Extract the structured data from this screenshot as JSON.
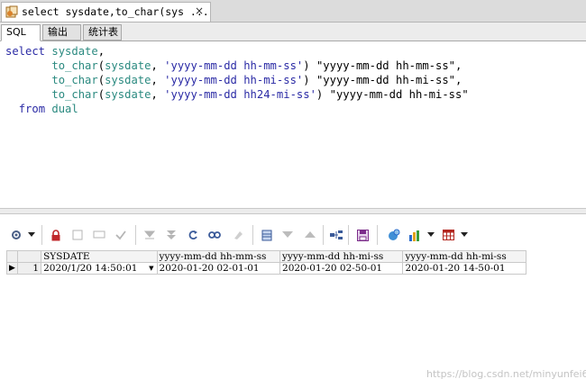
{
  "window": {
    "doc_tab_title": "select sysdate,to_char(sys ...",
    "close_glyph": "×"
  },
  "subtabs": [
    "SQL",
    "输出",
    "统计表"
  ],
  "editor": {
    "lines": [
      [
        {
          "t": "select ",
          "c": "kw"
        },
        {
          "t": "sysdate",
          "c": "fn"
        },
        {
          "t": ",",
          "c": "plain"
        }
      ],
      [
        {
          "t": "       ",
          "c": "plain"
        },
        {
          "t": "to_char",
          "c": "fn"
        },
        {
          "t": "(",
          "c": "plain"
        },
        {
          "t": "sysdate",
          "c": "fn"
        },
        {
          "t": ", ",
          "c": "plain"
        },
        {
          "t": "'yyyy-mm-dd hh-mm-ss'",
          "c": "str"
        },
        {
          "t": ") ",
          "c": "plain"
        },
        {
          "t": "\"yyyy-mm-dd hh-mm-ss\"",
          "c": "dq"
        },
        {
          "t": ",",
          "c": "plain"
        }
      ],
      [
        {
          "t": "       ",
          "c": "plain"
        },
        {
          "t": "to_char",
          "c": "fn"
        },
        {
          "t": "(",
          "c": "plain"
        },
        {
          "t": "sysdate",
          "c": "fn"
        },
        {
          "t": ", ",
          "c": "plain"
        },
        {
          "t": "'yyyy-mm-dd hh-mi-ss'",
          "c": "str"
        },
        {
          "t": ") ",
          "c": "plain"
        },
        {
          "t": "\"yyyy-mm-dd hh-mi-ss\"",
          "c": "dq"
        },
        {
          "t": ",",
          "c": "plain"
        }
      ],
      [
        {
          "t": "       ",
          "c": "plain"
        },
        {
          "t": "to_char",
          "c": "fn"
        },
        {
          "t": "(",
          "c": "plain"
        },
        {
          "t": "sysdate",
          "c": "fn"
        },
        {
          "t": ", ",
          "c": "plain"
        },
        {
          "t": "'yyyy-mm-dd hh24-mi-ss'",
          "c": "str"
        },
        {
          "t": ") ",
          "c": "plain"
        },
        {
          "t": "\"yyyy-mm-dd hh-mi-ss\"",
          "c": "dq"
        }
      ],
      [
        {
          "t": "  ",
          "c": "plain"
        },
        {
          "t": "from ",
          "c": "kw"
        },
        {
          "t": "dual",
          "c": "fn"
        }
      ]
    ]
  },
  "toolbar": {
    "icons": [
      "gear-icon",
      "dropdown-arrow-icon",
      "lock-icon",
      "clear-icon",
      "comment-icon",
      "check-icon",
      "move-down-icon",
      "move-bottom-icon",
      "refresh-icon",
      "find-icon",
      "eraser-icon",
      "grid-toggle-icon",
      "sort-down-icon",
      "sort-up-icon",
      "connect-icon",
      "save-icon",
      "query-icon",
      "chart-icon",
      "chart-dropdown-icon",
      "table-icon",
      "table-dropdown-icon"
    ]
  },
  "grid": {
    "columns": [
      "SYSDATE",
      "yyyy-mm-dd hh-mm-ss",
      "yyyy-mm-dd hh-mi-ss",
      "yyyy-mm-dd hh-mi-ss"
    ],
    "rows": [
      {
        "num": "1",
        "marker": "▶",
        "cells": [
          "2020/1/20 14:50:01",
          "2020-01-20 02-01-01",
          "2020-01-20 02-50-01",
          "2020-01-20 14-50-01"
        ]
      }
    ]
  },
  "watermark": "https://blog.csdn.net/minyunfei6",
  "colors": {
    "keyword": "#2a2aa5",
    "function": "#2b8a80",
    "lock": "#c0282b",
    "save": "#7b2c8a",
    "chart_bars": [
      "#2a6acb",
      "#e3a31b",
      "#3b9c3b",
      "#c0282b"
    ],
    "table": "#b3261e"
  }
}
